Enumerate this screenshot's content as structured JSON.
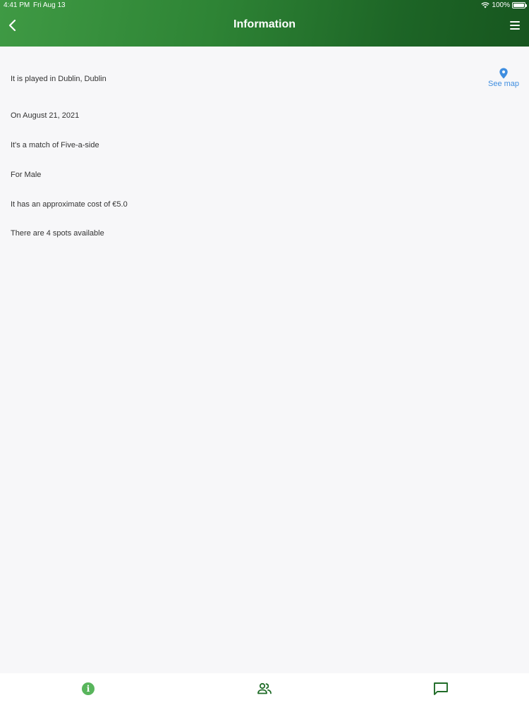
{
  "status_bar": {
    "time": "4:41 PM",
    "date": "Fri Aug 13",
    "battery": "100%"
  },
  "header": {
    "title": "Information",
    "back_icon": "chevron-left-icon",
    "menu_icon": "hamburger-menu-icon",
    "color_start": "#3f9a44",
    "color_end": "#17561f"
  },
  "info": {
    "location": "It is played in Dublin, Dublin",
    "date": "On August 21, 2021",
    "match_type": "It's a match of Five-a-side",
    "gender": "For Male",
    "cost": "It has an approximate cost of €5.0",
    "spots": "There are 4 spots available"
  },
  "see_map": {
    "label": "See map",
    "icon": "map-pin-icon",
    "color": "#3f8ee0"
  },
  "tabs": [
    {
      "name": "info",
      "icon": "info-circle-icon",
      "active": true
    },
    {
      "name": "players",
      "icon": "people-icon",
      "active": false
    },
    {
      "name": "chat",
      "icon": "chat-bubble-icon",
      "active": false
    }
  ]
}
